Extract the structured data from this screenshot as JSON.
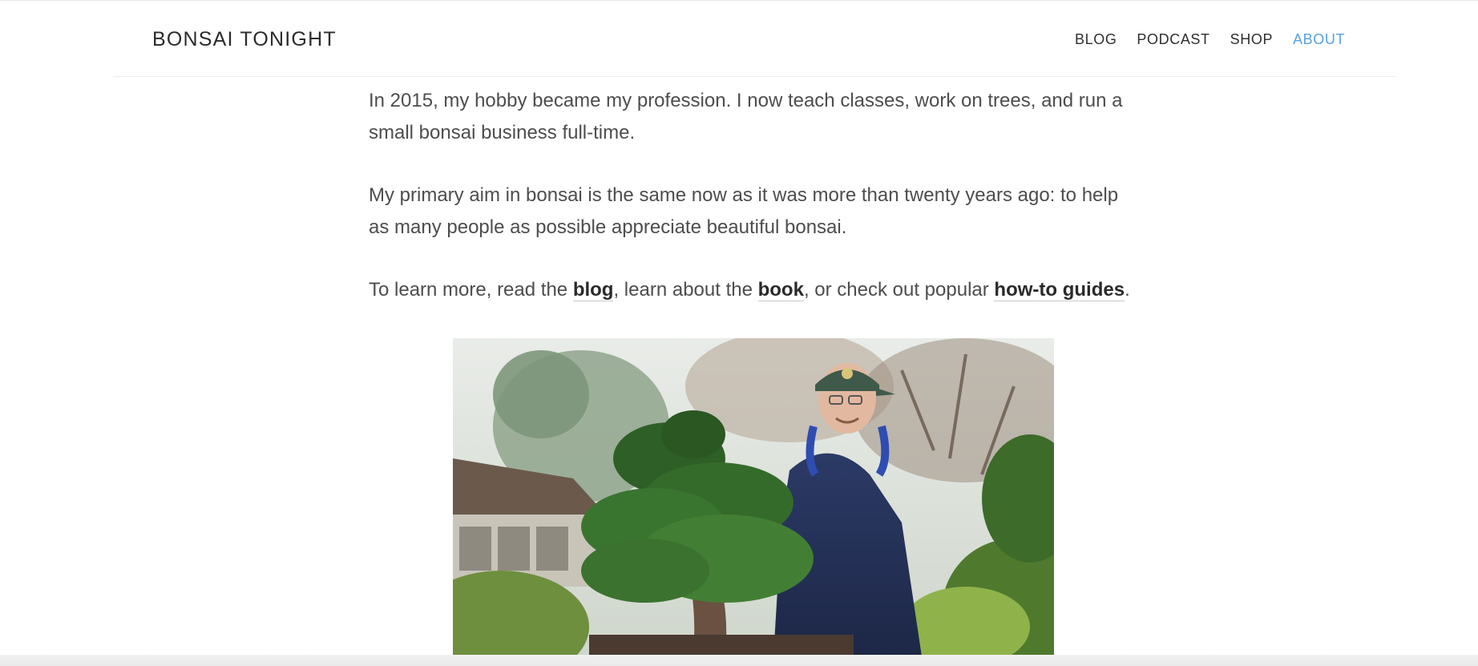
{
  "header": {
    "site_title": "BONSAI TONIGHT",
    "nav": [
      {
        "label": "BLOG",
        "active": false
      },
      {
        "label": "PODCAST",
        "active": false
      },
      {
        "label": "SHOP",
        "active": false
      },
      {
        "label": "ABOUT",
        "active": true
      }
    ]
  },
  "content": {
    "paragraph1": "In 2015, my hobby became my profession. I now teach classes, work on trees, and run a small bonsai business full-time.",
    "paragraph2": "My primary aim in bonsai is the same now as it was more than twenty years ago: to help as many people as possible appreciate beautiful bonsai.",
    "paragraph3": {
      "prefix": "To learn more, read the ",
      "link_blog": "blog",
      "middle1": ", learn about the ",
      "link_book": "book",
      "middle2": ", or check out popular ",
      "link_guides": "how-to guides",
      "suffix": "."
    }
  },
  "colors": {
    "accent": "#5aa2de",
    "text": "#4d4d4d",
    "link": "#2a2a2a"
  }
}
